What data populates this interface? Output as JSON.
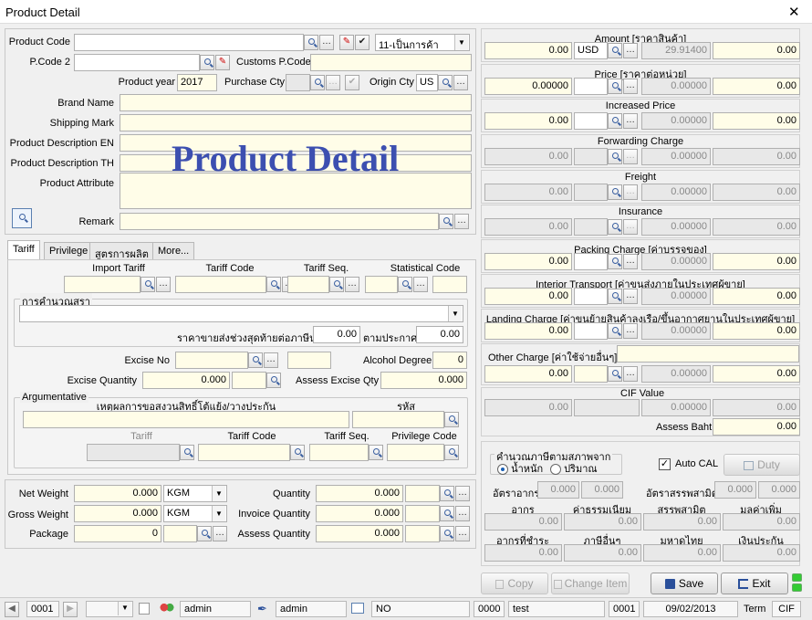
{
  "window": {
    "title": "Product Detail",
    "close": "✕",
    "watermark": "Product Detail"
  },
  "top": {
    "product_code_label": "Product Code",
    "product_code": "",
    "type_value": "11-เป็นการค้า",
    "pcode2_label": "P.Code 2",
    "pcode2": "",
    "customs_pcode_label": "Customs P.Code",
    "customs_pcode": "",
    "product_year_label": "Product year",
    "product_year": "2017",
    "purchase_cty_label": "Purchase Cty",
    "purchase_cty": "",
    "origin_cty_label": "Origin Cty",
    "origin_cty": "US",
    "brand_label": "Brand Name",
    "shipping_mark_label": "Shipping Mark",
    "desc_en_label": "Product Description EN",
    "desc_th_label": "Product Description TH",
    "attr_label": "Product Attribute",
    "remark_label": "Remark"
  },
  "tabs": [
    {
      "label": "Tariff"
    },
    {
      "label": "Privilege"
    },
    {
      "label": "สูตรการผลิต"
    },
    {
      "label": "More..."
    }
  ],
  "tariff": {
    "import_tariff": "Import Tariff",
    "tariff_code": "Tariff Code",
    "tariff_seq": "Tariff Seq.",
    "statistical_code": "Statistical Code",
    "calc_group": "การคำนวณสุรา",
    "last_price_label": "ราคาขายส่งช่วงสุดท้ายต่อภาษีนะ",
    "last_price": "0.00",
    "announce_label": "ตามประกาศ",
    "announce": "0.00",
    "excise_no": "Excise No",
    "alcohol_label": "Alcohol Degree",
    "alcohol": "0",
    "excise_qty_label": "Excise Quantity",
    "excise_qty": "0.000",
    "assess_excise_label": "Assess Excise Qty",
    "assess_excise": "0.000",
    "arg_group": "Argumentative",
    "arg_reason": "เหตุผลการขอสงวนสิทธิ์โต้แย้ง/วางประกัน",
    "arg_code": "รหัส",
    "tariff": "Tariff",
    "tariff_code2": "Tariff Code",
    "tariff_seq2": "Tariff Seq.",
    "privilege_code": "Privilege Code"
  },
  "weights": {
    "net_weight_label": "Net Weight",
    "net_weight": "0.000",
    "net_unit": "KGM",
    "gross_weight_label": "Gross Weight",
    "gross_weight": "0.000",
    "gross_unit": "KGM",
    "package_label": "Package",
    "package": "0",
    "quantity_label": "Quantity",
    "quantity": "0.000",
    "invoice_qty_label": "Invoice Quantity",
    "invoice_qty": "0.000",
    "assess_qty_label": "Assess Quantity",
    "assess_qty": "0.000"
  },
  "charges": [
    {
      "title": "Amount [ราคาสินค้า]",
      "v1": "0.00",
      "cur": "USD",
      "rate": "29.91400",
      "v2": "0.00"
    },
    {
      "title": "Price [ราคาต่อหน่วย]",
      "v1": "0.00000",
      "cur": "",
      "rate": "0.00000",
      "v2": "0.00"
    },
    {
      "title": "Increased Price",
      "v1": "0.00",
      "cur": "",
      "rate": "0.00000",
      "v2": "0.00"
    },
    {
      "title": "Forwarding Charge",
      "v1": "0.00",
      "cur": "",
      "rate": "0.00000",
      "v2": "0.00"
    },
    {
      "title": "Freight",
      "v1": "0.00",
      "cur": "",
      "rate": "0.00000",
      "v2": "0.00"
    },
    {
      "title": "Insurance",
      "v1": "0.00",
      "cur": "",
      "rate": "0.00000",
      "v2": "0.00"
    },
    {
      "title": "Packing Charge [ค่าบรรจุของ]",
      "v1": "0.00",
      "cur": "",
      "rate": "0.00000",
      "v2": "0.00"
    },
    {
      "title": "Interior Transport [ค่าขนส่งภายในประเทศผู้ขาย]",
      "v1": "0.00",
      "cur": "",
      "rate": "0.00000",
      "v2": "0.00"
    },
    {
      "title": "Landing Charge [ค่าขนย้ายสินค้าลงเรือ/ขึ้นอากาศยานในประเทศผู้ขาย]",
      "v1": "0.00",
      "cur": "",
      "rate": "0.00000",
      "v2": "0.00"
    }
  ],
  "other_charge": {
    "title": "Other Charge [ค่าใช้จ่ายอื่นๆ]",
    "v1": "0.00",
    "rate": "0.00000",
    "v2": "0.00"
  },
  "cif": {
    "title": "CIF Value",
    "v1": "0.00",
    "rate": "0.00000",
    "v2": "0.00",
    "assess_label": "Assess Baht",
    "assess": "0.00"
  },
  "duty": {
    "calc_group": "คำนวณภาษีตามสภาพจาก",
    "by_weight": "น้ำหนัก",
    "by_qty": "ปริมาณ",
    "auto_cal": "Auto CAL",
    "duty_btn": "Duty",
    "duty_rate_label": "อัตราอากร",
    "duty_rate1": "0.000",
    "duty_rate2": "0.000",
    "excise_rate_label": "อัตราสรรพสามิต",
    "excise_rate1": "0.000",
    "excise_rate2": "0.000",
    "h_duty": "อากร",
    "h_fee": "ค่าธรรมเนียม",
    "h_excise": "สรรพสามิต",
    "h_vat": "มูลค่าเพิ่ม",
    "duty": "0.00",
    "fee": "0.00",
    "excise": "0.00",
    "vat": "0.00",
    "h_paid": "อากรที่ชำระ",
    "h_other_tax": "ภาษีอื่นๆ",
    "h_interior": "มหาดไทย",
    "h_deposit": "เงินประกัน",
    "paid": "0.00",
    "other_tax": "0.00",
    "interior": "0.00",
    "deposit": "0.00"
  },
  "actions": {
    "copy": "Copy",
    "change_item": "Change Item",
    "save": "Save",
    "exit": "Exit"
  },
  "status": {
    "record": "0001",
    "user1": "admin",
    "user2": "admin",
    "flag": "NO",
    "code": "0000",
    "db": "test",
    "no": "0001",
    "date": "09/02/2013",
    "term_label": "Term",
    "term": "CIF"
  }
}
